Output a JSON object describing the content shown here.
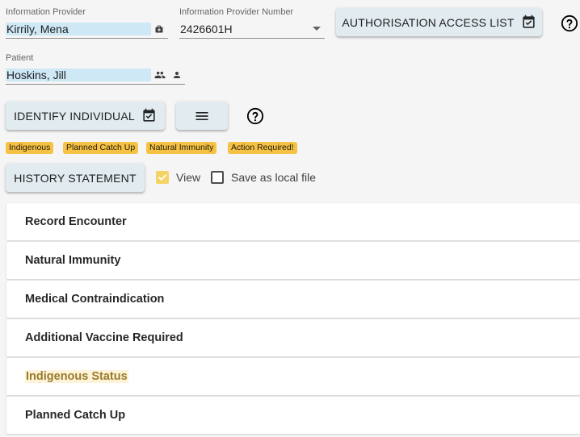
{
  "provider": {
    "label": "Information Provider",
    "value": "Kirrily, Mena",
    "icon": "medical-bag-icon"
  },
  "provider_number": {
    "label": "Information Provider Number",
    "value": "2426601H",
    "icon": "chevron-down-icon"
  },
  "auth_button": {
    "label": "AUTHORISATION ACCESS LIST",
    "icon": "calendar-check-icon"
  },
  "patient": {
    "label": "Patient",
    "value": "Hoskins, Jill",
    "icons": [
      "people-icon",
      "person-icon"
    ]
  },
  "identify_button": {
    "label": "IDENTIFY INDIVIDUAL",
    "icon": "calendar-check-icon"
  },
  "menu_button": {
    "icon": "menu-icon"
  },
  "chips": [
    "Indigenous",
    "Planned Catch Up",
    "Natural Immunity",
    "Action Required!"
  ],
  "history_button": {
    "label": "HISTORY STATEMENT"
  },
  "options": {
    "view": {
      "label": "View",
      "checked": true
    },
    "save_local": {
      "label": "Save as local file",
      "checked": false
    }
  },
  "panels": [
    {
      "title": "Record Encounter"
    },
    {
      "title": "Natural Immunity"
    },
    {
      "title": "Medical Contraindication"
    },
    {
      "title": "Additional Vaccine Required"
    },
    {
      "title": "Indigenous Status",
      "highlighted": true
    },
    {
      "title": "Planned Catch Up"
    }
  ],
  "colors": {
    "chip": "#f6c244",
    "field_highlight": "#cfe8f5",
    "button": "#e2ebef",
    "highlighted_title": "#9a7b2c"
  }
}
